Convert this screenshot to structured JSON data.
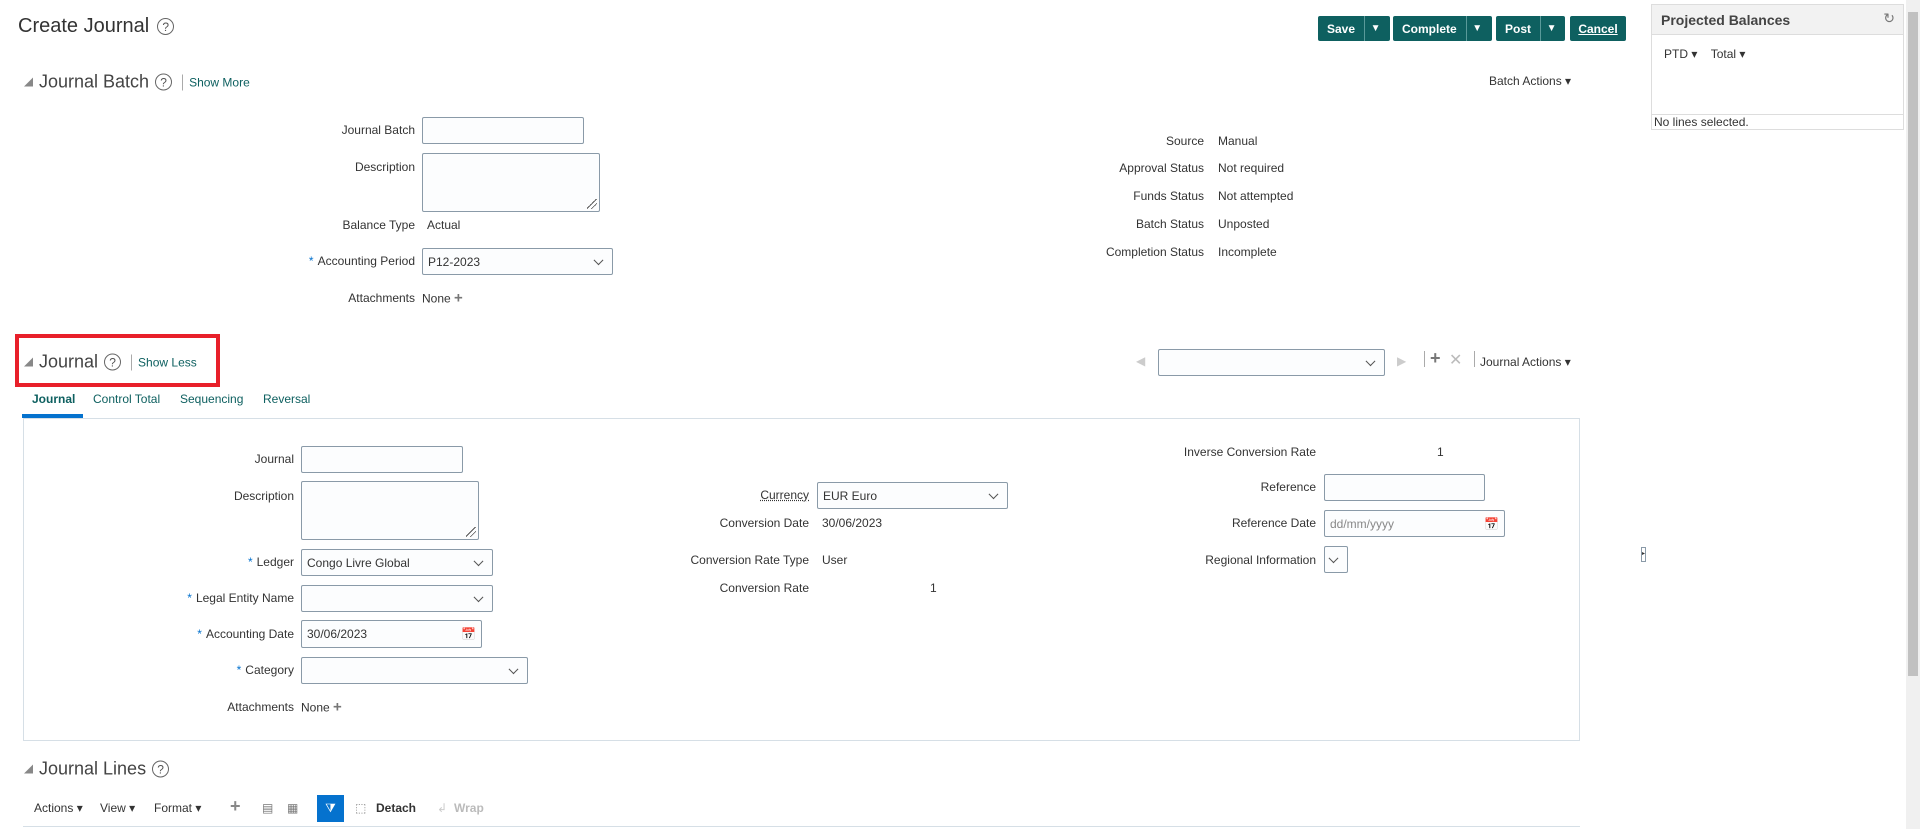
{
  "page": {
    "title": "Create Journal"
  },
  "toolbar": {
    "save": "Save",
    "complete": "Complete",
    "post": "Post",
    "cancel": "Cancel"
  },
  "projected_balances": {
    "title": "Projected Balances",
    "ptd": "PTD",
    "total": "Total",
    "status": "No lines selected."
  },
  "journal_batch": {
    "title": "Journal Batch",
    "show_more": "Show More",
    "batch_actions": "Batch Actions",
    "fields": {
      "journal_batch_label": "Journal Batch",
      "journal_batch_value": "",
      "description_label": "Description",
      "balance_type_label": "Balance Type",
      "balance_type_value": "Actual",
      "accounting_period_label": "Accounting Period",
      "accounting_period_value": "P12-2023",
      "attachments_label": "Attachments",
      "attachments_value": "None"
    },
    "status": [
      {
        "label": "Source",
        "value": "Manual"
      },
      {
        "label": "Approval Status",
        "value": "Not required"
      },
      {
        "label": "Funds Status",
        "value": "Not attempted"
      },
      {
        "label": "Batch Status",
        "value": "Unposted"
      },
      {
        "label": "Completion Status",
        "value": "Incomplete"
      }
    ]
  },
  "journal": {
    "title": "Journal",
    "show_less": "Show Less",
    "journal_actions": "Journal Actions",
    "tabs": [
      "Journal",
      "Control Total",
      "Sequencing",
      "Reversal"
    ],
    "left": {
      "journal_label": "Journal",
      "description_label": "Description",
      "ledger_label": "Ledger",
      "ledger_value": "Congo Livre Global",
      "legal_entity_label": "Legal Entity Name",
      "accounting_date_label": "Accounting Date",
      "accounting_date_value": "30/06/2023",
      "category_label": "Category",
      "attachments_label": "Attachments",
      "attachments_value": "None"
    },
    "middle": {
      "currency_label": "Currency",
      "currency_value": "EUR Euro",
      "conversion_date_label": "Conversion Date",
      "conversion_date_value": "30/06/2023",
      "conversion_rate_type_label": "Conversion Rate Type",
      "conversion_rate_type_value": "User",
      "conversion_rate_label": "Conversion Rate",
      "conversion_rate_value": "1"
    },
    "right": {
      "inverse_rate_label": "Inverse Conversion Rate",
      "inverse_rate_value": "1",
      "reference_label": "Reference",
      "reference_date_label": "Reference Date",
      "reference_date_placeholder": "dd/mm/yyyy",
      "regional_info_label": "Regional Information"
    }
  },
  "journal_lines": {
    "title": "Journal Lines",
    "actions": "Actions",
    "view": "View",
    "format": "Format",
    "detach": "Detach",
    "wrap": "Wrap"
  }
}
